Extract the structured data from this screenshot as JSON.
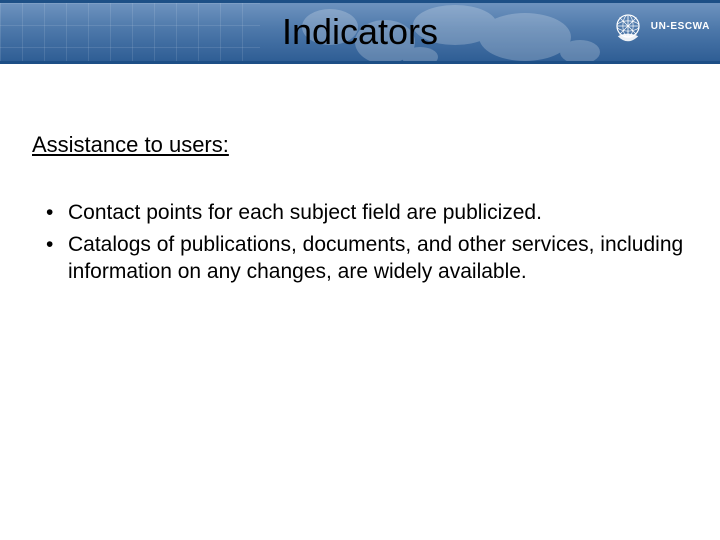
{
  "header": {
    "title": "Indicators",
    "org_label": "UN-ESCWA",
    "logo_name": "un-emblem-icon"
  },
  "section_title": "Assistance to users:",
  "bullets": [
    "Contact points for each subject field are publicized.",
    "Catalogs of publications, documents, and other services, including information on any changes, are widely available."
  ]
}
